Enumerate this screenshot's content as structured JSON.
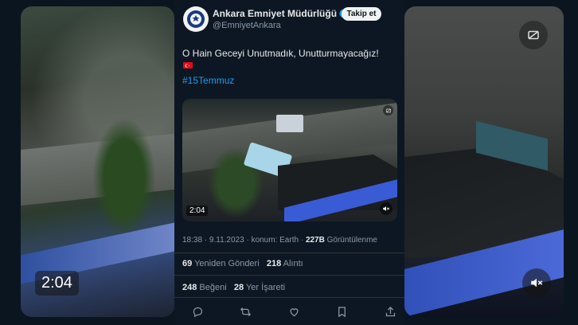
{
  "tweet": {
    "author_name": "Ankara Emniyet Müdürlüğü",
    "author_handle": "@EmniyetAnkara",
    "follow_label": "Takip et",
    "text": "O Hain Geceyi Unutmadık, Unutturmayacağız!",
    "hashtag": "#15Temmuz",
    "media": {
      "duration": "2:04"
    },
    "meta": {
      "time": "18:38",
      "date": "9.11.2023",
      "location": "konum: Earth",
      "views_count": "227B",
      "views_label": "Görüntülenme"
    },
    "stats": {
      "retweets_count": "69",
      "retweets_label": "Yeniden Gönderi",
      "quotes_count": "218",
      "quotes_label": "Alıntı",
      "likes_count": "248",
      "likes_label": "Beğeni",
      "bookmarks_count": "28",
      "bookmarks_label": "Yer İşareti"
    },
    "colors": {
      "link": "#1d9bf0",
      "background": "#0d1723",
      "muted": "#8b98a5"
    }
  },
  "background_video": {
    "duration": "2:04"
  },
  "icons": [
    "verified-badge-icon",
    "turkish-flag-icon",
    "mute-icon",
    "gif-icon",
    "reply-icon",
    "retweet-icon",
    "like-icon",
    "bookmark-icon",
    "share-icon"
  ]
}
